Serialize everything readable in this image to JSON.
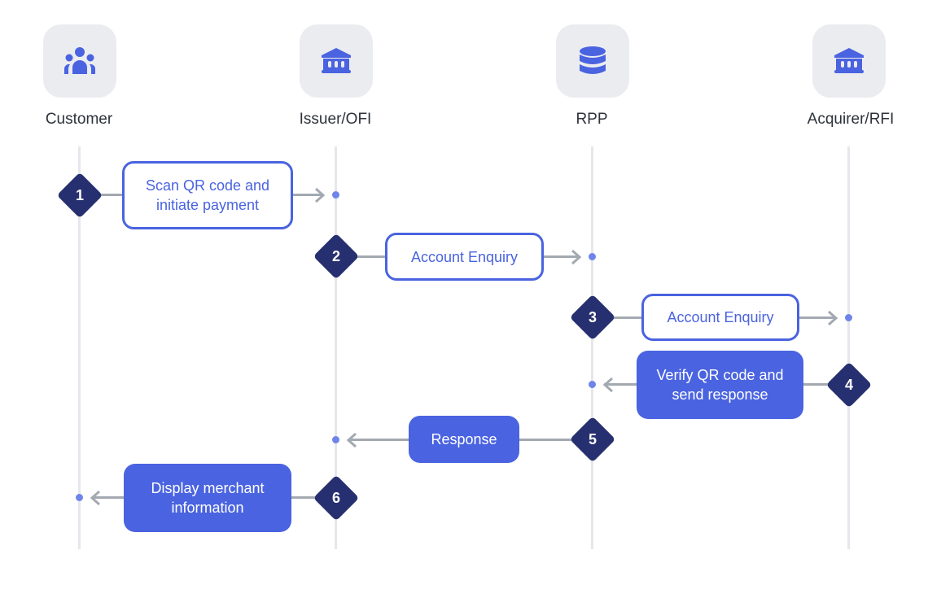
{
  "colors": {
    "accent": "#4a63e0",
    "step_marker": "#263070",
    "lifeline": "#e6e7ec",
    "connector": "#a3a9b1",
    "icon_tile": "#ebecf0"
  },
  "actors": [
    {
      "label": "Customer",
      "icon": "people-group-icon"
    },
    {
      "label": "Issuer/OFI",
      "icon": "bank-icon"
    },
    {
      "label": "RPP",
      "icon": "database-icon"
    },
    {
      "label": "Acquirer/RFI",
      "icon": "bank-icon"
    }
  ],
  "steps": [
    {
      "number": "1",
      "from": "Customer",
      "to": "Issuer/OFI",
      "label": "Scan QR code and\ninitiate payment",
      "style": "outline"
    },
    {
      "number": "2",
      "from": "Issuer/OFI",
      "to": "RPP",
      "label": "Account Enquiry",
      "style": "outline"
    },
    {
      "number": "3",
      "from": "RPP",
      "to": "Acquirer/RFI",
      "label": "Account Enquiry",
      "style": "outline"
    },
    {
      "number": "4",
      "from": "Acquirer/RFI",
      "to": "RPP",
      "label": "Verify QR code and\nsend response",
      "style": "filled"
    },
    {
      "number": "5",
      "from": "RPP",
      "to": "Issuer/OFI",
      "label": "Response",
      "style": "filled"
    },
    {
      "number": "6",
      "from": "Issuer/OFI",
      "to": "Customer",
      "label": "Display merchant\ninformation",
      "style": "filled"
    }
  ]
}
